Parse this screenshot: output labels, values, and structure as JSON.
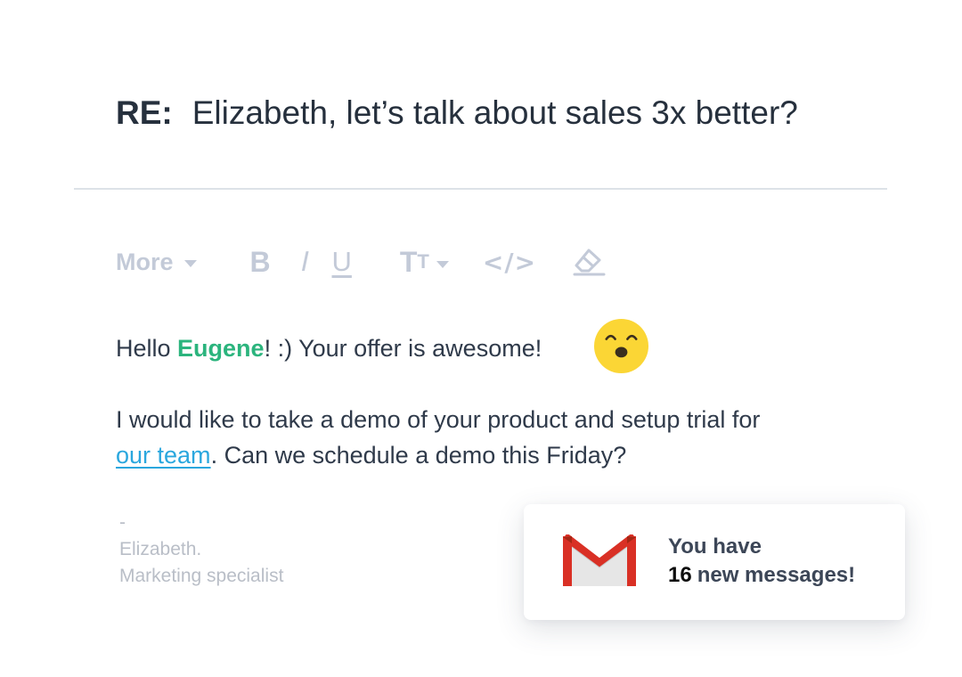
{
  "subject": {
    "prefix": "RE:",
    "text": "Elizabeth, let’s talk about sales 3x better?"
  },
  "toolbar": {
    "more_label": "More",
    "bold_label": "B",
    "italic_label": "I",
    "underline_label": "U",
    "size_big": "T",
    "size_small": "T",
    "code_label": "</>",
    "icons": [
      "caret-down-icon",
      "eraser-icon"
    ]
  },
  "message": {
    "greeting_prefix": "Hello ",
    "recipient_name": "Eugene",
    "greeting_suffix": "! :) Your offer is awesome!",
    "emoji": "happy-face-emoji",
    "line2": "I would like to take a demo of your product and setup trial for",
    "link_text": "our team",
    "line3_suffix": ". Can we schedule a demo this Friday?"
  },
  "signature": {
    "dash": "-",
    "name": "Elizabeth.",
    "title": "Marketing specialist"
  },
  "notification": {
    "icon": "gmail-icon",
    "line1": "You have",
    "count": "16",
    "line2_suffix": "new messages!"
  },
  "colors": {
    "text": "#2f3a4a",
    "name_green": "#2bb47d",
    "link_blue": "#2aa7de",
    "toolbar_gray": "#c3cad8",
    "signature_gray": "#b9bec7",
    "gmail_red": "#d93025"
  }
}
